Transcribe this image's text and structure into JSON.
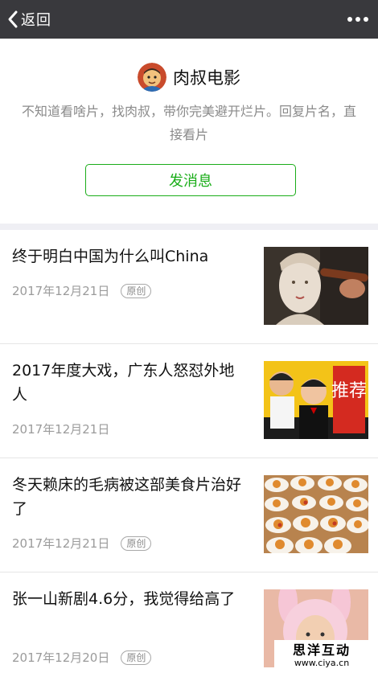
{
  "navbar": {
    "back_label": "返回",
    "more_icon": "more-icon"
  },
  "account": {
    "name": "肉叔电影",
    "description": "不知道看啥片，找肉叔，带你完美避开烂片。回复片名，直接看片",
    "send_button_label": "发消息",
    "accent_color": "#1aad19"
  },
  "articles": [
    {
      "title": "终于明白中国为什么叫China",
      "date": "2017年12月21日",
      "badge": "原创",
      "thumb_hint": "porcelain-statue"
    },
    {
      "title": "2017年度大戏，广东人怒怼外地人",
      "date": "2017年12月21日",
      "badge": "",
      "thumb_hint": "actors-recommend",
      "thumb_text": "推荐"
    },
    {
      "title": "冬天赖床的毛病被这部美食片治好了",
      "date": "2017年12月21日",
      "badge": "原创",
      "thumb_hint": "food-plates"
    },
    {
      "title": "张一山新剧4.6分，我觉得给高了",
      "date": "2017年12月20日",
      "badge": "原创",
      "thumb_hint": "pink-bunny-hat"
    }
  ],
  "watermark": {
    "title": "思洋互动",
    "url": "www.ciya.cn"
  }
}
